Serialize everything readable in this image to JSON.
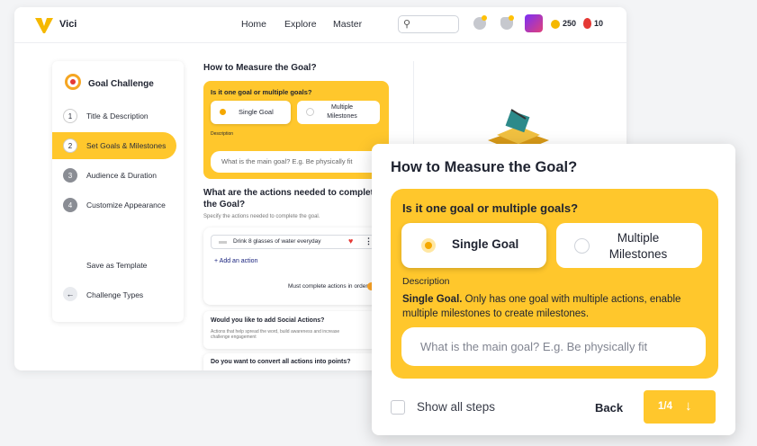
{
  "app": {
    "brand": "Vici"
  },
  "nav": {
    "home": "Home",
    "explore": "Explore",
    "master": "Master"
  },
  "stats": {
    "coins": "250",
    "potions": "10"
  },
  "sidebar": {
    "title": "Goal Challenge",
    "steps": [
      {
        "num": "1",
        "label": "Title & Description"
      },
      {
        "num": "2",
        "label": "Set Goals & Milestones"
      },
      {
        "num": "3",
        "label": "Audience & Duration"
      },
      {
        "num": "4",
        "label": "Customize Appearance"
      }
    ],
    "save_template": "Save as Template",
    "challenge_types": "Challenge Types"
  },
  "main": {
    "heading": "How to Measure the Goal?",
    "question": "Is it one goal or multiple goals?",
    "option_single": "Single Goal",
    "option_multiple": "Multiple Milestones",
    "desc_label": "Description",
    "goal_placeholder": "What is the main goal? E.g. Be physically fit",
    "actions_heading": "What are the actions needed to complete the Goal?",
    "actions_sub": "Specify the actions needed to complete the goal.",
    "action_item": "Drink 8 glasses of water everyday",
    "add_action": "Add an action",
    "must_complete": "Must complete actions in order",
    "social_title": "Would you like to add Social Actions?",
    "social_desc": "Actions that help spread the word, build awareness and increase challenge engagement",
    "points_title": "Do you want to convert all actions into points?"
  },
  "dialog": {
    "title": "How to Measure the Goal?",
    "question": "Is it one goal or multiple goals?",
    "option_single": "Single Goal",
    "option_multiple": "Multiple Milestones",
    "desc_label": "Description",
    "help_bold": "Single Goal.",
    "help_text": " Only has one goal with multiple actions, enable multiple milestones to create milestones.",
    "goal_placeholder": "What is the main goal? E.g. Be physically fit",
    "show_all": "Show all steps",
    "back": "Back",
    "step_counter": "1/4",
    "next_arrow": "↓"
  },
  "colors": {
    "accent": "#ffc72c",
    "text": "#1f2330"
  }
}
